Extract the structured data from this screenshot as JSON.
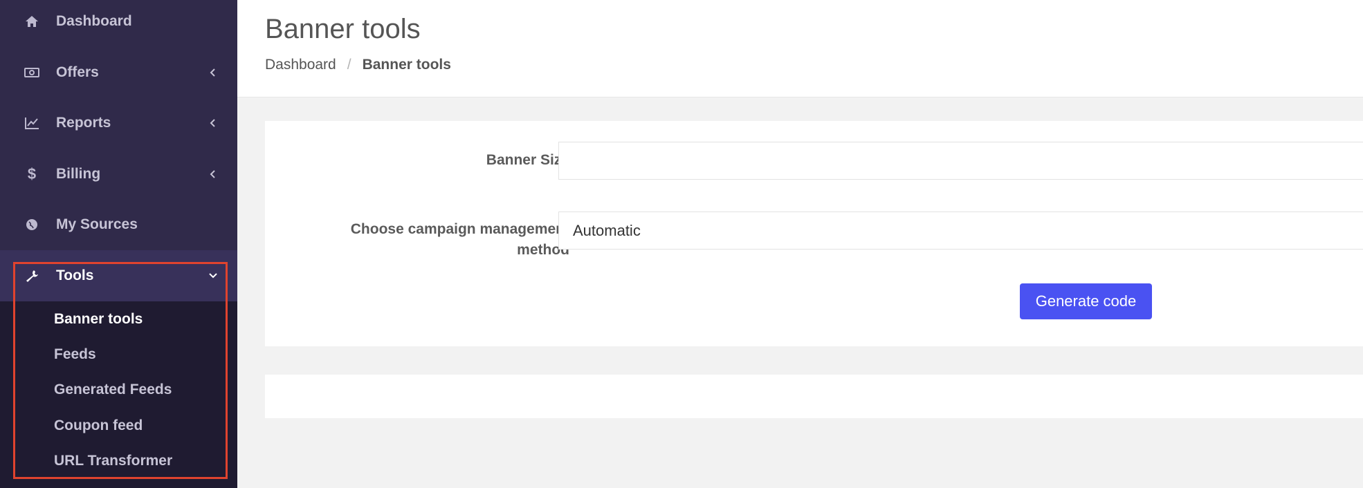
{
  "sidebar": {
    "items": [
      {
        "label": "Dashboard",
        "icon": "home-icon"
      },
      {
        "label": "Offers",
        "icon": "money-icon"
      },
      {
        "label": "Reports",
        "icon": "chart-line-icon"
      },
      {
        "label": "Billing",
        "icon": "dollar-icon"
      },
      {
        "label": "My Sources",
        "icon": "globe-icon"
      },
      {
        "label": "Tools",
        "icon": "wrench-icon"
      }
    ],
    "submenu": [
      {
        "label": "Banner tools"
      },
      {
        "label": "Feeds"
      },
      {
        "label": "Generated Feeds"
      },
      {
        "label": "Coupon feed"
      },
      {
        "label": "URL Transformer"
      }
    ]
  },
  "header": {
    "title": "Banner tools",
    "breadcrumb": {
      "root": "Dashboard",
      "separator": "/",
      "current": "Banner tools"
    }
  },
  "form": {
    "banner_size_label": "Banner Size",
    "banner_size_value": "",
    "campaign_label_line1": "Choose campaign management",
    "campaign_label_line2": "method",
    "campaign_value": "Automatic",
    "generate_label": "Generate code"
  },
  "colors": {
    "sidebar_bg": "#302a4a",
    "submenu_bg": "#1f1b31",
    "accent": "#4a52f2",
    "highlight": "#e0432e"
  }
}
